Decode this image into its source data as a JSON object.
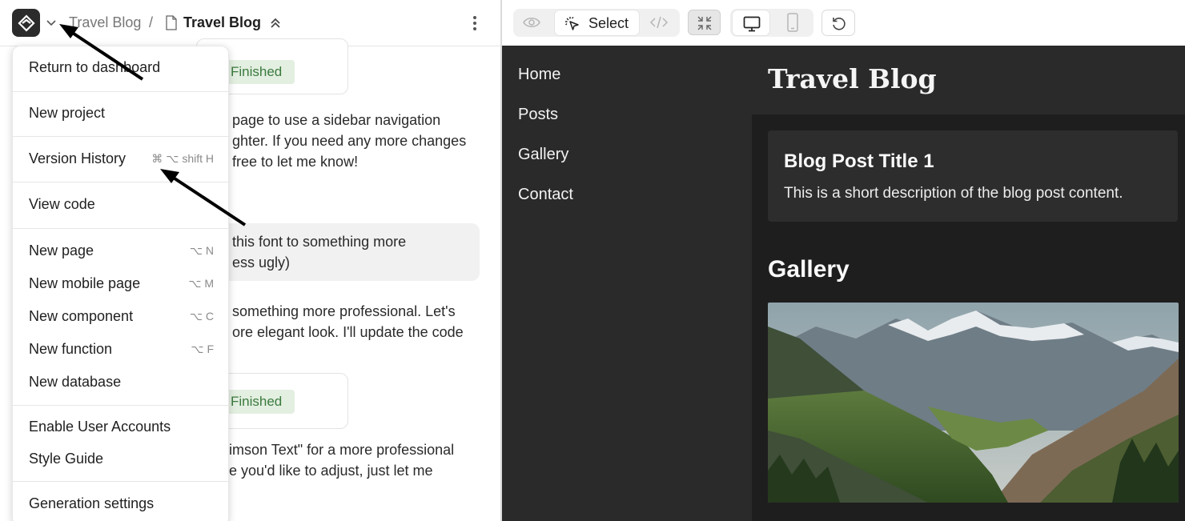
{
  "left_header": {
    "breadcrumb_parent": "Travel Blog",
    "breadcrumb_separator": "/",
    "breadcrumb_current": "Travel Blog"
  },
  "chat": {
    "status_badge_1": "Finished",
    "status_badge_2": "Finished",
    "message_1_lines": [
      "page to use a sidebar navigation",
      "ghter. If you need any more changes",
      "free to let me know!"
    ],
    "user_message_lines": [
      "this font to something more",
      "ess ugly)"
    ],
    "message_2_lines": [
      "something more professional. Let's",
      "ore elegant look. I'll update the code"
    ],
    "message_3_lines": [
      "imson Text\" for a more professional",
      "e you'd like to adjust, just let me"
    ]
  },
  "menu": {
    "return_to_dashboard": "Return to dashboard",
    "new_project": "New project",
    "version_history": "Version History",
    "version_history_shortcut": "⌘ ⌥ shift H",
    "view_code": "View code",
    "new_page": "New page",
    "new_page_shortcut": "⌥ N",
    "new_mobile_page": "New mobile page",
    "new_mobile_page_shortcut": "⌥ M",
    "new_component": "New component",
    "new_component_shortcut": "⌥ C",
    "new_function": "New function",
    "new_function_shortcut": "⌥ F",
    "new_database": "New database",
    "enable_user_accounts": "Enable User Accounts",
    "style_guide": "Style Guide",
    "generation_settings": "Generation settings"
  },
  "toolbar": {
    "select_label": "Select",
    "icons": [
      "eye-icon",
      "cursor-select-icon",
      "code-icon",
      "shrink-icon",
      "desktop-icon",
      "mobile-icon",
      "reload-icon"
    ]
  },
  "preview": {
    "nav_items": [
      "Home",
      "Posts",
      "Gallery",
      "Contact"
    ],
    "site_title": "Travel Blog",
    "post_title": "Blog Post Title 1",
    "post_description": "This is a short description of the blog post content.",
    "gallery_heading": "Gallery"
  },
  "colors": {
    "badge_bg": "#e3efe1",
    "badge_text": "#3b7a3e",
    "preview_bg": "#1e1e1e",
    "sidebar_bg": "#2a2a2a"
  }
}
